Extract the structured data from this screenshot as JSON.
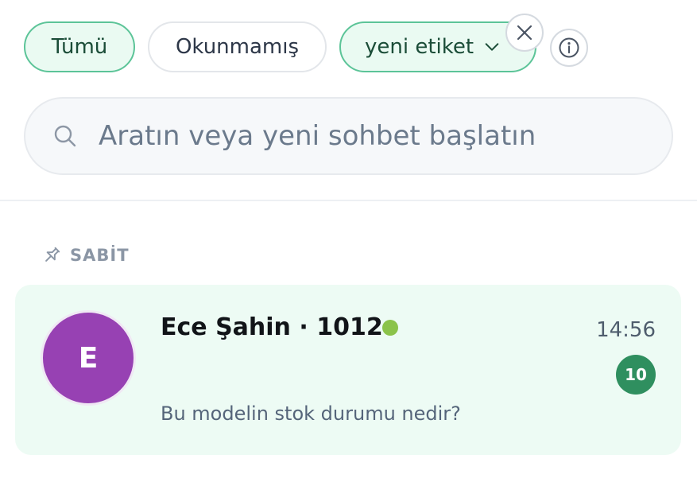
{
  "filters": {
    "all_label": "Tümü",
    "unread_label": "Okunmamış",
    "tag_label": "yeni etiket"
  },
  "search": {
    "placeholder": "Aratın veya yeni sohbet başlatın"
  },
  "pinned": {
    "section_label": "SABİT",
    "conversations": [
      {
        "avatar_initial": "E",
        "avatar_color": "#9741b3",
        "name": "Ece Şahin · 1012",
        "online": true,
        "time": "14:56",
        "unread_count": "10",
        "preview": "Bu modelin stok durumu nedir?"
      }
    ]
  },
  "colors": {
    "accent": "#5cc498",
    "badge": "#2f8f5f",
    "online": "#8bc34a"
  },
  "icons": {
    "clear": "close-icon",
    "info": "info-icon",
    "search": "search-icon",
    "pin": "pin-icon",
    "tag_dropdown": "chevron-down-icon"
  }
}
